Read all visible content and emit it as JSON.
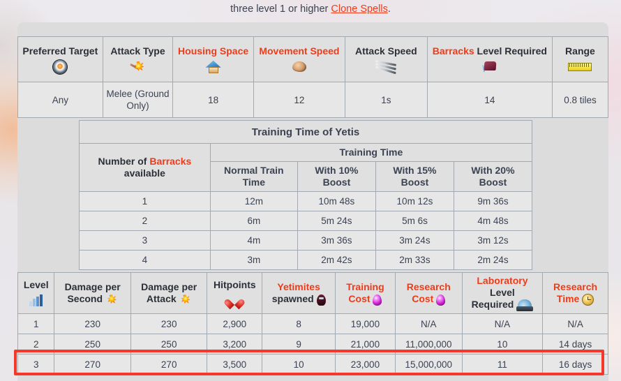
{
  "top_text": {
    "prefix": "three level 1 or higher ",
    "link": "Clone Spells",
    "suffix": "."
  },
  "stats_table": {
    "headers": [
      {
        "label_plain": "Preferred Target",
        "icon": "target-icon"
      },
      {
        "label_plain": "Attack Type",
        "icon": "attack-burst-icon"
      },
      {
        "label_orange": "Housing Space",
        "icon": "house-icon"
      },
      {
        "label_orange": "Movement Speed",
        "icon": "fist-icon"
      },
      {
        "label_plain": "Attack Speed",
        "icon": "swords-icon"
      },
      {
        "label_orange": "Barracks",
        "label_plain": " Level Required",
        "icon": "barracks-icon"
      },
      {
        "label_plain": "Range",
        "icon": "ruler-icon"
      }
    ],
    "header_labels": {
      "preferred_target": "Preferred Target",
      "attack_type": "Attack Type",
      "housing_space": "Housing Space",
      "movement_speed": "Movement Speed",
      "attack_speed": "Attack Speed",
      "barracks_orange": "Barracks",
      "barracks_rest": "Level Required",
      "range": "Range"
    },
    "values": {
      "preferred_target": "Any",
      "attack_type": "Melee (Ground Only)",
      "housing_space": "18",
      "movement_speed": "12",
      "attack_speed": "1s",
      "barracks_level_required": "14",
      "range": "0.8 tiles"
    }
  },
  "training_table": {
    "caption": "Training Time of Yetis",
    "col_number_prefix": "Number of ",
    "col_number_orange": "Barracks",
    "col_number_suffix": "available",
    "group_header": "Training Time",
    "subheaders": [
      "Normal Train Time",
      "With 10% Boost",
      "With 15% Boost",
      "With 20% Boost"
    ],
    "rows": [
      {
        "barracks": "1",
        "normal": "12m",
        "boost10": "10m 48s",
        "boost15": "10m 12s",
        "boost20": "9m 36s"
      },
      {
        "barracks": "2",
        "normal": "6m",
        "boost10": "5m 24s",
        "boost15": "5m 6s",
        "boost20": "4m 48s"
      },
      {
        "barracks": "3",
        "normal": "4m",
        "boost10": "3m 36s",
        "boost15": "3m 24s",
        "boost20": "3m 12s"
      },
      {
        "barracks": "4",
        "normal": "3m",
        "boost10": "2m 42s",
        "boost15": "2m 33s",
        "boost20": "2m 24s"
      }
    ]
  },
  "levels_table": {
    "headers": {
      "level": "Level",
      "dps_l1": "Damage per",
      "dps_l2": "Second",
      "dpa_l1": "Damage per",
      "dpa_l2": "Attack",
      "hitpoints": "Hitpoints",
      "yetimites_l1": "Yetimites",
      "yetimites_l2": "spawned",
      "training_cost_l1": "Training",
      "training_cost_l2": "Cost",
      "research_cost_l1": "Research",
      "research_cost_l2": "Cost",
      "lab_l1_orange": "Laboratory",
      "lab_l1_rest": "Level",
      "lab_l2": "Required",
      "research_time_l1": "Research",
      "research_time_l2": "Time"
    },
    "rows": [
      {
        "level": "1",
        "dps": "230",
        "dpa": "230",
        "hitpoints": "2,900",
        "yetimites": "8",
        "training_cost": "19,000",
        "research_cost": "N/A",
        "lab_level": "N/A",
        "research_time": "N/A",
        "highlighted": false
      },
      {
        "level": "2",
        "dps": "250",
        "dpa": "250",
        "hitpoints": "3,200",
        "yetimites": "9",
        "training_cost": "21,000",
        "research_cost": "11,000,000",
        "lab_level": "10",
        "research_time": "14 days",
        "highlighted": false
      },
      {
        "level": "3",
        "dps": "270",
        "dpa": "270",
        "hitpoints": "3,500",
        "yetimites": "10",
        "training_cost": "23,000",
        "research_cost": "15,000,000",
        "lab_level": "11",
        "research_time": "16 days",
        "highlighted": true
      }
    ]
  },
  "colors": {
    "link_orange": "#f03b18",
    "text_dark": "#3b4252",
    "highlight_red": "#f4392c",
    "table_bg": "#e7e7e7",
    "panel_bg": "#dcdcdc",
    "border": "#a2a9b1"
  }
}
